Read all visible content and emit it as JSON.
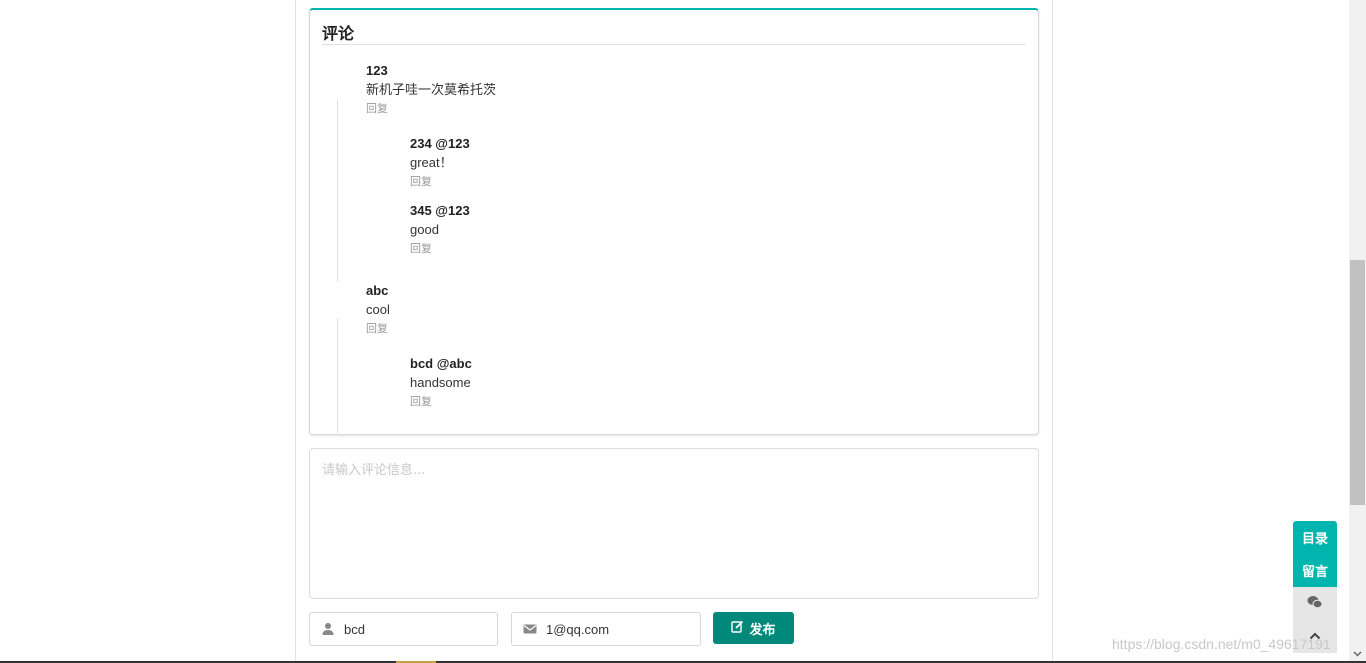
{
  "comments_section": {
    "title": "评论",
    "reply_label": "回复",
    "threads": [
      {
        "author": "123",
        "content": "新机子哇一次莫希托茨",
        "replies": [
          {
            "author": "234 @123",
            "content": "great！"
          },
          {
            "author": "345 @123",
            "content": "good"
          }
        ]
      },
      {
        "author": "abc",
        "content": "cool",
        "replies": [
          {
            "author": "bcd @abc",
            "content": "handsome"
          }
        ]
      }
    ]
  },
  "form": {
    "comment_placeholder": "请输入评论信息...",
    "nickname_value": "bcd",
    "email_value": "1@qq.com",
    "submit_label": "发布"
  },
  "side_widget": {
    "toc_label": "目录",
    "message_label": "留言",
    "wechat_icon": "wechat-icon",
    "top_icon": "chevron-up-icon"
  },
  "watermark": "https://blog.csdn.net/m0_49617191",
  "colors": {
    "accent": "#00b5ad",
    "button": "#00897b"
  }
}
